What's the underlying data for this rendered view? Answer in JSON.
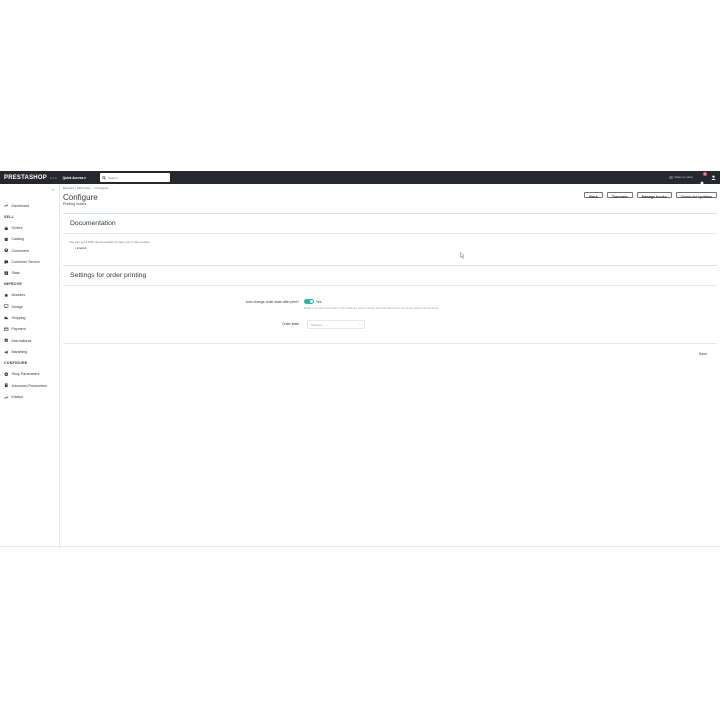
{
  "header": {
    "logo": "PRESTASHOP",
    "version": "8.1.0",
    "quick_access": "Quick Access ▾",
    "search_placeholder": "Search",
    "view_store": "View my store",
    "notifications_count": "6"
  },
  "sidebar": {
    "collapse": "«",
    "items": [
      {
        "type": "item",
        "label": "Dashboard",
        "icon": "trending-up-icon"
      },
      {
        "type": "section",
        "label": "SELL"
      },
      {
        "type": "item",
        "label": "Orders",
        "icon": "basket-icon"
      },
      {
        "type": "item",
        "label": "Catalog",
        "icon": "store-icon"
      },
      {
        "type": "item",
        "label": "Customers",
        "icon": "account-icon"
      },
      {
        "type": "item",
        "label": "Customer Service",
        "icon": "chat-icon"
      },
      {
        "type": "item",
        "label": "Stats",
        "icon": "bar-chart-icon"
      },
      {
        "type": "section",
        "label": "IMPROVE"
      },
      {
        "type": "item",
        "label": "Modules",
        "icon": "puzzle-icon"
      },
      {
        "type": "item",
        "label": "Design",
        "icon": "desktop-icon"
      },
      {
        "type": "item",
        "label": "Shipping",
        "icon": "truck-icon"
      },
      {
        "type": "item",
        "label": "Payment",
        "icon": "credit-card-icon"
      },
      {
        "type": "item",
        "label": "International",
        "icon": "globe-icon"
      },
      {
        "type": "item",
        "label": "Marketing",
        "icon": "megaphone-icon"
      },
      {
        "type": "section",
        "label": "CONFIGURE"
      },
      {
        "type": "item",
        "label": "Shop Parameters",
        "icon": "settings-icon"
      },
      {
        "type": "item",
        "label": "Advanced Parameters",
        "icon": "device-hub-icon"
      },
      {
        "type": "item",
        "label": "Klaviyo",
        "icon": "trending-icon"
      }
    ]
  },
  "content": {
    "breadcrumb": "Modules  /  pdfinvoice...  /  Configure",
    "title": "Configure",
    "subtitle": "Printing orders",
    "toolbar": [
      "Back",
      "Translate",
      "Manage hooks",
      "Check for updates"
    ]
  },
  "documentation": {
    "heading": "Documentation",
    "text": "You can get a PDF documentation to help you in this module :",
    "link": "English"
  },
  "settings": {
    "heading": "Settings for order printing",
    "auto_label": "Auto change order state after print?",
    "auto_value": "Yes",
    "auto_help": "Enable if you want to print orders. This module are going to change their order status to the one you are going to choose below.",
    "state_label": "Order state",
    "state_value": "Shipped",
    "save": "Save"
  },
  "colors": {
    "header_bg": "#25292d",
    "accent": "#25b9a7",
    "badge": "#e54b7c"
  }
}
